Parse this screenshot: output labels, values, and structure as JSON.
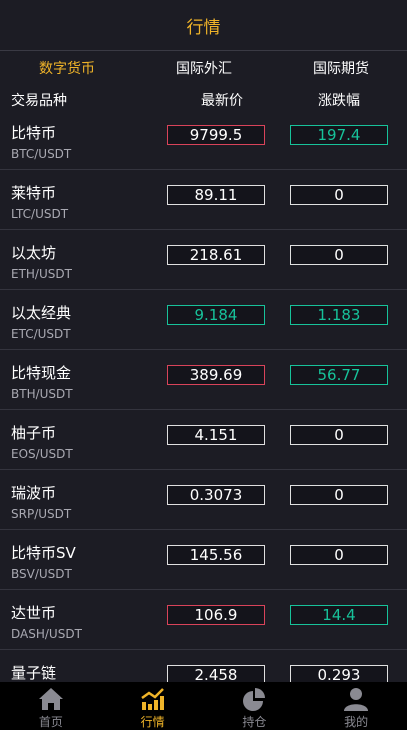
{
  "header": {
    "title": "行情"
  },
  "tabs": [
    {
      "label": "数字货币",
      "active": true
    },
    {
      "label": "国际外汇",
      "active": false
    },
    {
      "label": "国际期货",
      "active": false
    }
  ],
  "columns": {
    "name": "交易品种",
    "price": "最新价",
    "change": "涨跌幅"
  },
  "rows": [
    {
      "name": "比特币",
      "pair": "BTC/USDT",
      "price": "9799.5",
      "change": "197.4",
      "price_state": "down",
      "change_state": "up"
    },
    {
      "name": "莱特币",
      "pair": "LTC/USDT",
      "price": "89.11",
      "change": "0",
      "price_state": "flat",
      "change_state": "flat"
    },
    {
      "name": "以太坊",
      "pair": "ETH/USDT",
      "price": "218.61",
      "change": "0",
      "price_state": "flat",
      "change_state": "flat"
    },
    {
      "name": "以太经典",
      "pair": "ETC/USDT",
      "price": "9.184",
      "change": "1.183",
      "price_state": "up",
      "change_state": "up"
    },
    {
      "name": "比特现金",
      "pair": "BTH/USDT",
      "price": "389.69",
      "change": "56.77",
      "price_state": "down",
      "change_state": "up"
    },
    {
      "name": "柚子币",
      "pair": "EOS/USDT",
      "price": "4.151",
      "change": "0",
      "price_state": "flat",
      "change_state": "flat"
    },
    {
      "name": "瑞波币",
      "pair": "SRP/USDT",
      "price": "0.3073",
      "change": "0",
      "price_state": "flat",
      "change_state": "flat"
    },
    {
      "name": "比特币SV",
      "pair": "BSV/USDT",
      "price": "145.56",
      "change": "0",
      "price_state": "flat",
      "change_state": "flat"
    },
    {
      "name": "达世币",
      "pair": "DASH/USDT",
      "price": "106.9",
      "change": "14.4",
      "price_state": "down",
      "change_state": "up"
    },
    {
      "name": "量子链",
      "pair": "",
      "price": "2.458",
      "change": "0.293",
      "price_state": "flat",
      "change_state": "flat"
    }
  ],
  "tabbar": [
    {
      "label": "首页",
      "icon": "home-icon",
      "active": false
    },
    {
      "label": "行情",
      "icon": "market-chart-icon",
      "active": true
    },
    {
      "label": "持仓",
      "icon": "pie-chart-icon",
      "active": false
    },
    {
      "label": "我的",
      "icon": "user-icon",
      "active": false
    }
  ],
  "colors": {
    "accent": "#f0b429",
    "up": "#17c29a",
    "down": "#d9435a",
    "background": "#1c1c24"
  }
}
